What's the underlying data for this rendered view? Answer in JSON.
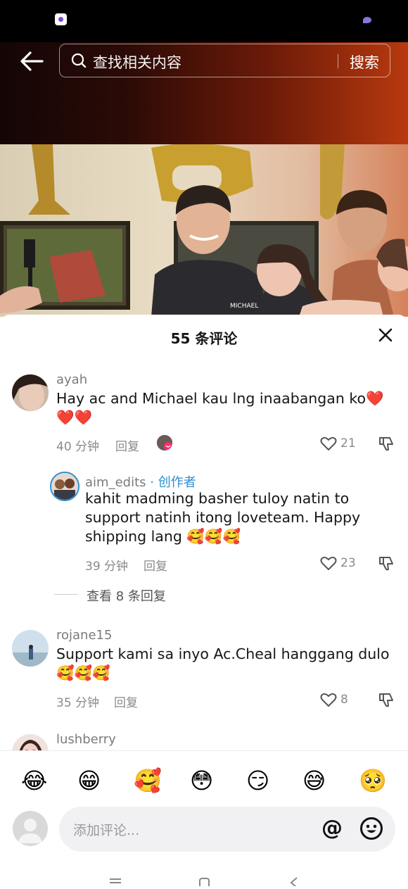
{
  "search": {
    "placeholder": "查找相关内容",
    "button_label": "搜索"
  },
  "video": {
    "shirt_text": "MICHAEL"
  },
  "comments_sheet": {
    "title": "55 条评论",
    "reply_label": "回复",
    "comments": [
      {
        "username": "ayah",
        "text": "Hay ac and Michael kau lng inaabangan ko❤️❤️❤️",
        "time": "40 分钟",
        "likes": "21"
      },
      {
        "username": "aim_edits",
        "author_tag": "· 创作者",
        "text": "kahit madming basher tuloy natin to support natinh itong loveteam. Happy shipping lang 🥰🥰🥰",
        "time": "39 分钟",
        "likes": "23"
      },
      {
        "username": "rojane15",
        "text": "Support kami sa inyo Ac.Cheal hanggang dulo🥰🥰🥰",
        "time": "35 分钟",
        "likes": "8"
      },
      {
        "username": "lushberry"
      }
    ],
    "view_replies": "查看 8 条回复"
  },
  "emoji_bar": [
    "😂",
    "😁",
    "🥰",
    "😳",
    "😏",
    "😅",
    "🥺"
  ],
  "composer": {
    "placeholder": "添加评论...",
    "at_label": "@"
  },
  "colors": {
    "author_tag": "#2d8fd0",
    "heart_badge": "#ff2d6f"
  },
  "icons": [
    "back-arrow-icon",
    "search-icon",
    "close-icon",
    "heart-icon",
    "dislike-icon",
    "smiley-icon",
    "menu-icon",
    "home-icon",
    "back-icon"
  ]
}
